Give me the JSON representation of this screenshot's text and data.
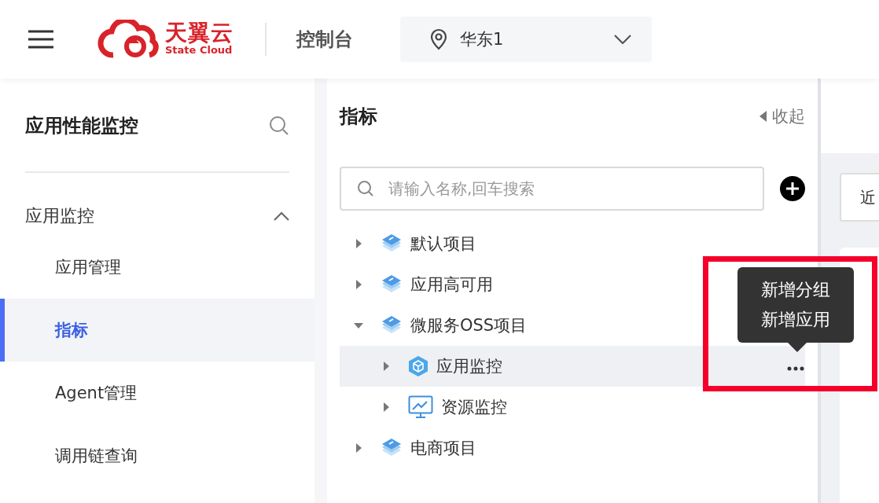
{
  "header": {
    "logo_text": "天翼云",
    "logo_subtext": "State Cloud",
    "console": "控制台",
    "region": "华东1"
  },
  "sidebar": {
    "title": "应用性能监控",
    "groups": [
      {
        "label": "应用监控",
        "expanded": true,
        "items": [
          {
            "label": "应用管理",
            "selected": false
          },
          {
            "label": "指标",
            "selected": true
          },
          {
            "label": "Agent管理",
            "selected": false
          },
          {
            "label": "调用链查询",
            "selected": false
          }
        ]
      }
    ]
  },
  "panel": {
    "title": "指标",
    "collapse": "收起",
    "search": {
      "placeholder": "请输入名称,回车搜索"
    },
    "tree": [
      {
        "label": "默认项目",
        "kind": "project",
        "expanded": false,
        "selected": false
      },
      {
        "label": "应用高可用",
        "kind": "project",
        "expanded": false,
        "selected": false
      },
      {
        "label": "微服务OSS项目",
        "kind": "project",
        "expanded": true,
        "selected": false,
        "children": [
          {
            "label": "应用监控",
            "kind": "app",
            "expanded": false,
            "selected": true
          },
          {
            "label": "资源监控",
            "kind": "resource",
            "expanded": false,
            "selected": false
          }
        ]
      },
      {
        "label": "电商项目",
        "kind": "project",
        "expanded": false,
        "selected": false
      }
    ],
    "tooltip": [
      "新增分组",
      "新增应用"
    ]
  },
  "content": {
    "button": "近"
  }
}
